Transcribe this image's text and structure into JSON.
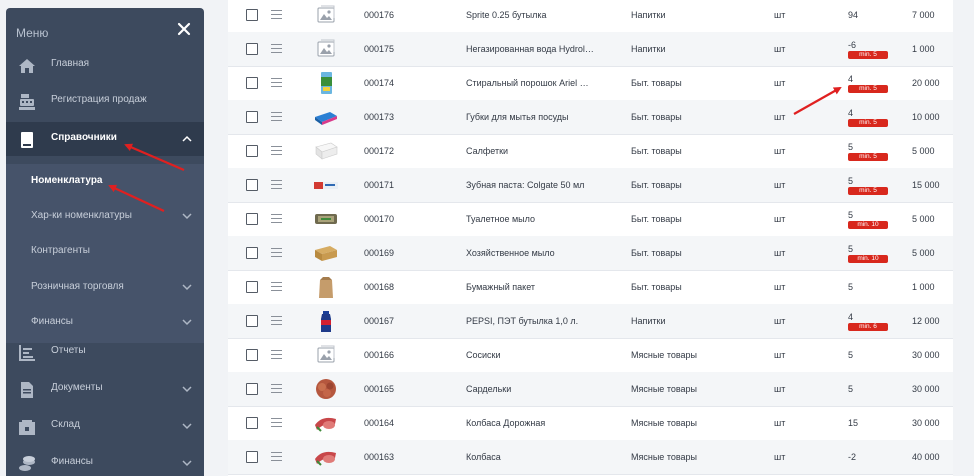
{
  "sidebar": {
    "title": "Меню",
    "items": [
      {
        "label": "Главная"
      },
      {
        "label": "Регистрация продаж"
      },
      {
        "label": "Справочники"
      },
      {
        "label": "Отчеты"
      },
      {
        "label": "Документы"
      },
      {
        "label": "Склад"
      },
      {
        "label": "Финансы"
      }
    ],
    "submenu": [
      {
        "label": "Номенклатура"
      },
      {
        "label": "Хар-ки номенклатуры"
      },
      {
        "label": "Контрагенты"
      },
      {
        "label": "Розничная торговля"
      },
      {
        "label": "Финансы"
      }
    ]
  },
  "products": [
    {
      "code": "000176",
      "name": "Sprite 0.25 бутылка",
      "category": "Напитки",
      "unit": "шт",
      "qty": "94",
      "min": "",
      "price": "7 000",
      "img": "placeholder"
    },
    {
      "code": "000175",
      "name": "Негазированная вода Hydroli...",
      "category": "Напитки",
      "unit": "шт",
      "qty": "-6",
      "min": "min. 5",
      "price": "1 000",
      "img": "placeholder"
    },
    {
      "code": "000174",
      "name": "Стиральный порошок Ariel Fr...",
      "category": "Быт. товары",
      "unit": "шт",
      "qty": "4",
      "min": "min. 5",
      "price": "20 000",
      "img": "powder"
    },
    {
      "code": "000173",
      "name": "Губки для мытья посуды",
      "category": "Быт. товары",
      "unit": "шт",
      "qty": "4",
      "min": "min. 5",
      "price": "10 000",
      "img": "sponge"
    },
    {
      "code": "000172",
      "name": "Салфетки",
      "category": "Быт. товары",
      "unit": "шт",
      "qty": "5",
      "min": "min. 5",
      "price": "5 000",
      "img": "napkins"
    },
    {
      "code": "000171",
      "name": "Зубная паста: Colgate 50 мл",
      "category": "Быт. товары",
      "unit": "шт",
      "qty": "5",
      "min": "min. 5",
      "price": "15 000",
      "img": "toothpaste"
    },
    {
      "code": "000170",
      "name": "Туалетное мыло",
      "category": "Быт. товары",
      "unit": "шт",
      "qty": "5",
      "min": "min. 10",
      "price": "5 000",
      "img": "soap"
    },
    {
      "code": "000169",
      "name": "Хозяйственное мыло",
      "category": "Быт. товары",
      "unit": "шт",
      "qty": "5",
      "min": "min. 10",
      "price": "5 000",
      "img": "soapbox"
    },
    {
      "code": "000168",
      "name": "Бумажный пакет",
      "category": "Быт. товары",
      "unit": "шт",
      "qty": "5",
      "min": "",
      "price": "1 000",
      "img": "bag"
    },
    {
      "code": "000167",
      "name": "PEPSI, ПЭТ бутылка 1,0 л.",
      "category": "Напитки",
      "unit": "шт",
      "qty": "4",
      "min": "min. 6",
      "price": "12 000",
      "img": "pepsi"
    },
    {
      "code": "000166",
      "name": "Сосиски",
      "category": "Мясные товары",
      "unit": "шт",
      "qty": "5",
      "min": "",
      "price": "30 000",
      "img": "placeholder"
    },
    {
      "code": "000165",
      "name": "Сардельки",
      "category": "Мясные товары",
      "unit": "шт",
      "qty": "5",
      "min": "",
      "price": "30 000",
      "img": "sausage"
    },
    {
      "code": "000164",
      "name": "Колбаса Дорожная",
      "category": "Мясные товары",
      "unit": "шт",
      "qty": "15",
      "min": "",
      "price": "30 000",
      "img": "salami"
    },
    {
      "code": "000163",
      "name": "Колбаса",
      "category": "Мясные товары",
      "unit": "шт",
      "qty": "-2",
      "min": "",
      "price": "40 000",
      "img": "salami"
    }
  ],
  "colors": {
    "sidebar_bg": "#3d4a5e",
    "sidebar_active": "#2f3b4d",
    "min_badge": "#d8281d",
    "annotation_arrow": "#e02020"
  }
}
